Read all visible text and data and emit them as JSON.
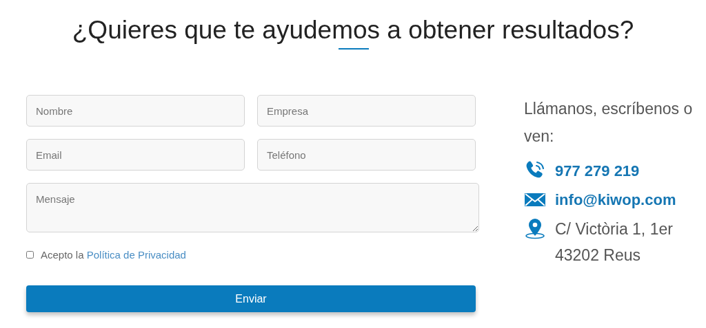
{
  "heading": "¿Quieres que te ayudemos a obtener resultados?",
  "form": {
    "fields": [
      {
        "placeholder": "Nombre",
        "kind": "input"
      },
      {
        "placeholder": "Empresa",
        "kind": "input"
      },
      {
        "placeholder": "Email",
        "kind": "input"
      },
      {
        "placeholder": "Teléfono",
        "kind": "input"
      },
      {
        "placeholder": "Mensaje",
        "kind": "textarea"
      }
    ],
    "consent": {
      "checked": false,
      "text": "Acepto la",
      "link": "Política de Privacidad"
    },
    "submit": "Enviar"
  },
  "contact": {
    "intro": "Llámanos, escríbenos o ven:",
    "items": [
      {
        "kind": "phone",
        "text": "977 279 219"
      },
      {
        "kind": "email",
        "text": "info@kiwop.com"
      },
      {
        "kind": "address",
        "text": "C/ Victòria 1, 1er 43202 Reus"
      }
    ]
  }
}
